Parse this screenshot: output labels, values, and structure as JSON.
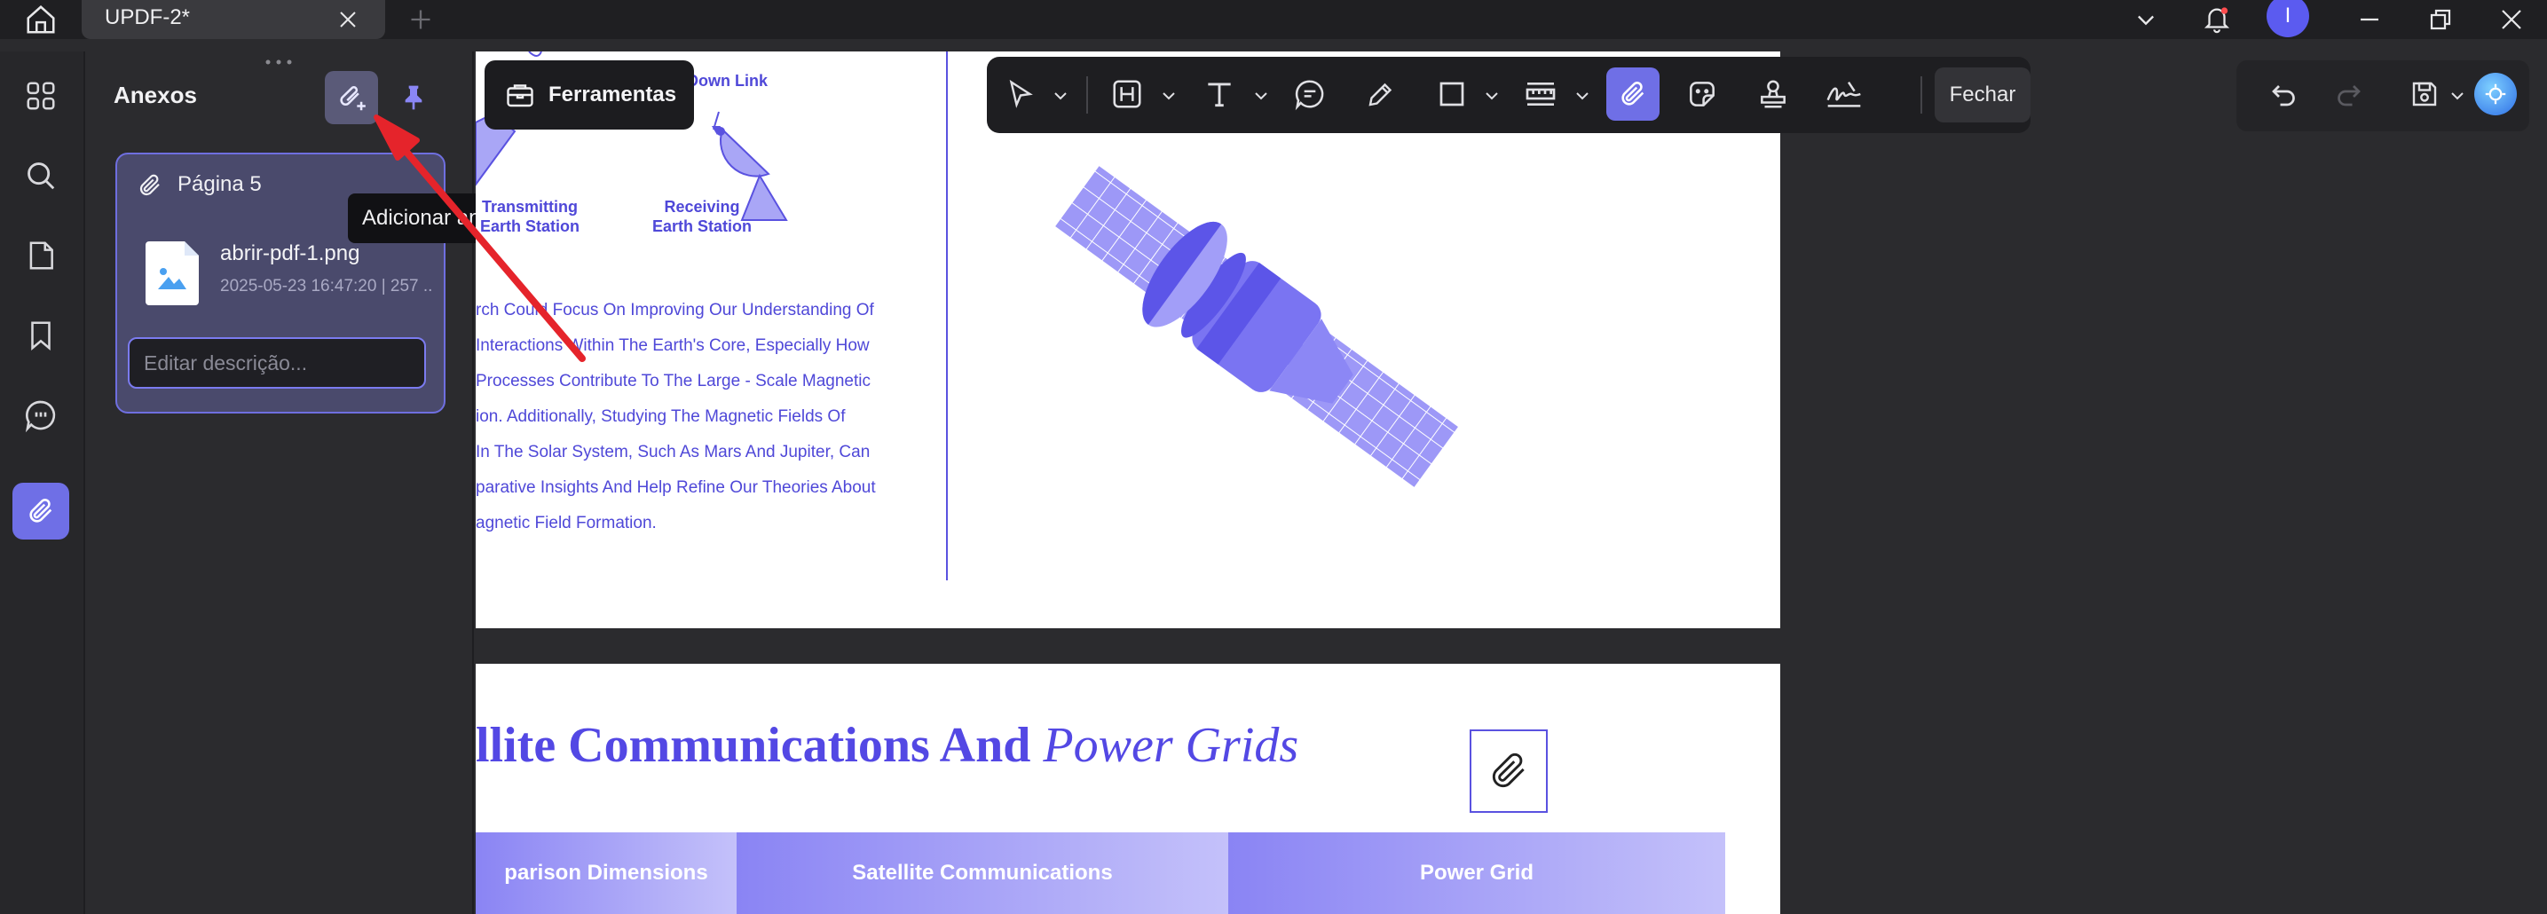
{
  "tab": {
    "title": "UPDF-2*"
  },
  "panel": {
    "title": "Anexos",
    "tooltip": "Adicionar anexo",
    "card": {
      "page_label": "Página 5",
      "file_name": "abrir-pdf-1.png",
      "file_meta": "2025-05-23 16:47:20 | 257 ...",
      "description_placeholder": "Editar descrição..."
    }
  },
  "toolbar": {
    "tools_label": "Ferramentas",
    "close_label": "Fechar"
  },
  "document": {
    "diagram": {
      "down_link": "Down Link",
      "transmitting_line1": "Transmitting",
      "transmitting_line2": "Earth Station",
      "receiving_line1": "Receiving",
      "receiving_line2": "Earth Station"
    },
    "paragraph_lines": [
      "rch Could Focus On Improving Our Understanding Of",
      "Interactions Within The Earth's Core, Especially How",
      "Processes Contribute To The Large - Scale Magnetic",
      "ion. Additionally, Studying The Magnetic Fields Of",
      "In The Solar System, Such As Mars And Jupiter, Can",
      "parative Insights And Help Refine Our Theories About",
      "agnetic Field Formation."
    ],
    "section_title_bold": "llite Communications And ",
    "section_title_italic": "Power Grids",
    "table_headers": [
      "parison Dimensions",
      "Satellite Communications",
      "Power Grid"
    ]
  },
  "user": {
    "avatar_letter": "I"
  },
  "colors": {
    "accent": "#6f6fe6",
    "doc_text": "#4f48d8",
    "arrow": "#e5242b"
  }
}
